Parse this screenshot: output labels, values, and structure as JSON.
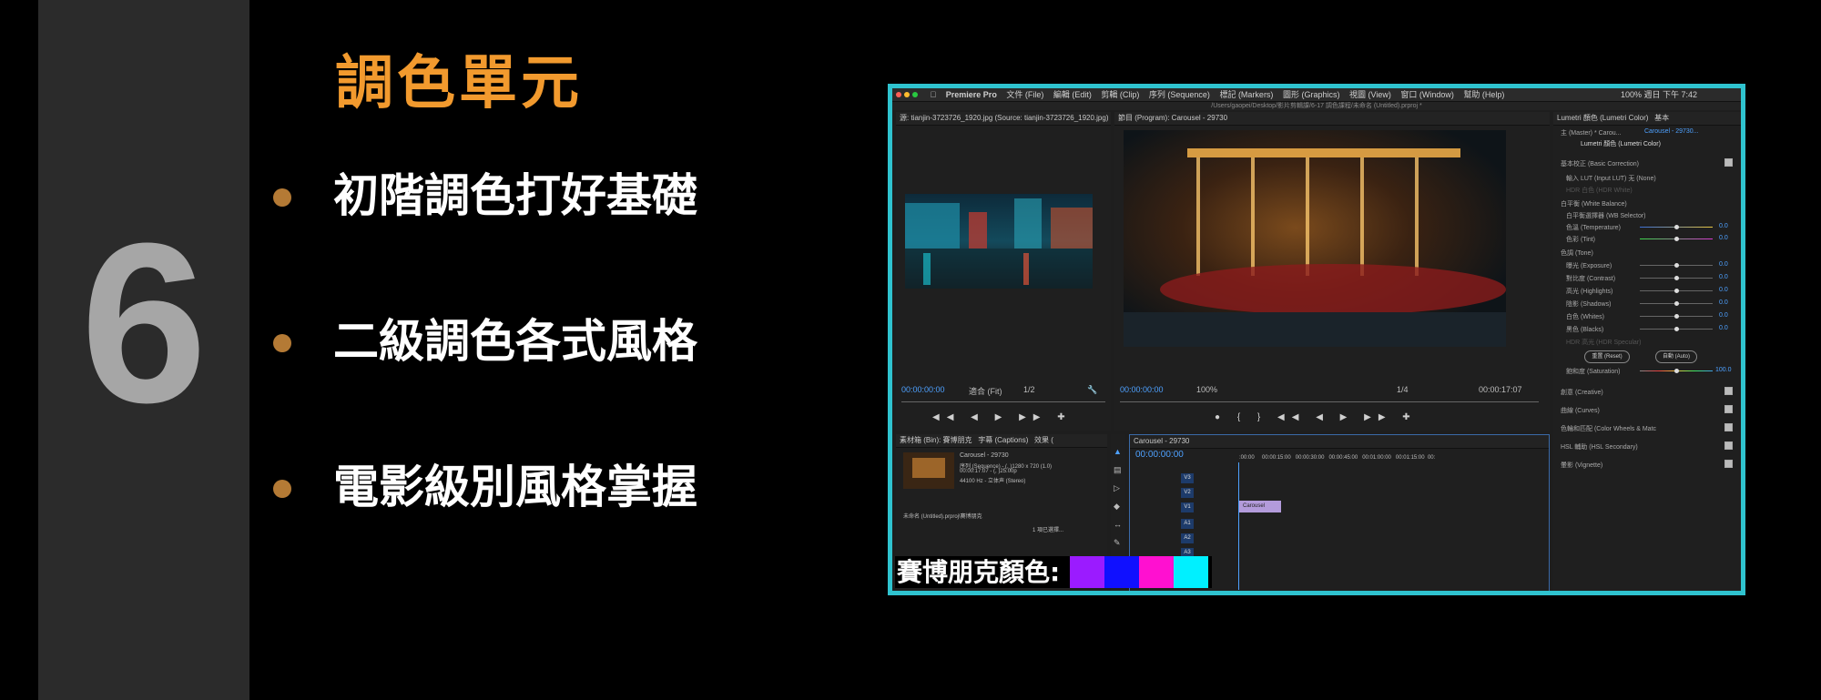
{
  "slide": {
    "number": "6",
    "title": "調色單元",
    "bullets": [
      "初階調色打好基礎",
      "二級調色各式風格",
      "電影級別風格掌握"
    ]
  },
  "premiere": {
    "menu": [
      "Premiere Pro",
      "文件 (File)",
      "編輯 (Edit)",
      "剪輯 (Clip)",
      "序列 (Sequence)",
      "標記 (Markers)",
      "圖形 (Graphics)",
      "視圖 (View)",
      "窗口 (Window)",
      "幫助 (Help)"
    ],
    "clock": "100%  週日 下午 7:42",
    "path": "/Users/gaopei/Desktop/影片剪輯課/6-17 調色課程/未命名 (Untitled).prproj *",
    "source_title": "源: tianjin-3723726_1920.jpg (Source: tianjin-3723726_1920.jpg)",
    "program_title": "節目 (Program): Carousel - 29730",
    "source_tc": "00:00:00:00",
    "source_fit": "適合 (Fit)",
    "source_res": "1/2",
    "program_tc": "00:00:00:00",
    "program_zoom": "100%",
    "program_res": "1/4",
    "program_dur": "00:00:17:07",
    "bin_tabs": [
      "素材箱 (Bin): 賽博朋克",
      "字幕 (Captions)",
      "效果 ("
    ],
    "clip_name": "Carousel - 29730",
    "clip_info": [
      "序列 (Sequence) - (, )1280 x 720 (1.0)",
      "00:00:17:07 - (, )25.00p",
      "44100 Hz - 立体声 (Stereo)"
    ],
    "bin_footer": "未命名 (Untitled).prproj\\賽博朋克",
    "bin_sel": "1 項已選擇...",
    "timeline_title": "Carousel - 29730",
    "timeline_tc": "00:00:00:00",
    "ruler": [
      ":00:00",
      "00:00:15:00",
      "00:00:30:00",
      "00:00:45:00",
      "00:01:00:00",
      "00:01:15:00",
      "00:"
    ],
    "tracks": [
      "V3",
      "V2",
      "V1",
      "A1",
      "A2",
      "A3"
    ],
    "clip_label": "Carousel",
    "lumetri_tabs": [
      "Lumetri 顏色 (Lumetri Color)",
      "基本"
    ],
    "lumetri_master": "主 (Master) * Carou...",
    "lumetri_seq": "Carousel - 29730...",
    "lumetri_fx": "Lumetri 顏色 (Lumetri Color)",
    "lumetri_rows": [
      {
        "label": "基本校正 (Basic Correction)"
      },
      {
        "label": "輸入 LUT (Input LUT)   无 (None)"
      },
      {
        "label": "HDR 白色 (HDR White)"
      },
      {
        "label": "白平衡 (White Balance)"
      },
      {
        "label": "白平衡選擇器 (WB Selector)"
      },
      {
        "label": "色溫 (Temperature)",
        "value": "0.0"
      },
      {
        "label": "色彩 (Tint)",
        "value": "0.0"
      },
      {
        "label": "色調 (Tone)"
      },
      {
        "label": "曝光 (Exposure)",
        "value": "0.0"
      },
      {
        "label": "對比度 (Contrast)",
        "value": "0.0"
      },
      {
        "label": "高光 (Highlights)",
        "value": "0.0"
      },
      {
        "label": "陰影 (Shadows)",
        "value": "0.0"
      },
      {
        "label": "白色 (Whites)",
        "value": "0.0"
      },
      {
        "label": "黑色 (Blacks)",
        "value": "0.0"
      },
      {
        "label": "HDR 高光 (HDR Specular)"
      }
    ],
    "reset_label": "重置 (Reset)",
    "auto_label": "自動 (Auto)",
    "saturation_label": "飽和度 (Saturation)",
    "saturation_value": "100.0",
    "lumetri_sections": [
      "創意 (Creative)",
      "曲線 (Curves)",
      "色輪和匹配 (Color Wheels & Matc",
      "HSL 輔助 (HSL Secondary)",
      "暈影 (Vignette)"
    ]
  },
  "cyberpunk": {
    "label": "賽博朋克顏色:",
    "colors": [
      "#9b1bff",
      "#1010ff",
      "#ff10d0",
      "#00f0ff"
    ]
  },
  "colors": {
    "accent_orange": "#f29a2e",
    "frame_cyan": "#2fc3cf",
    "stripe_gray": "#2b2b2b"
  }
}
